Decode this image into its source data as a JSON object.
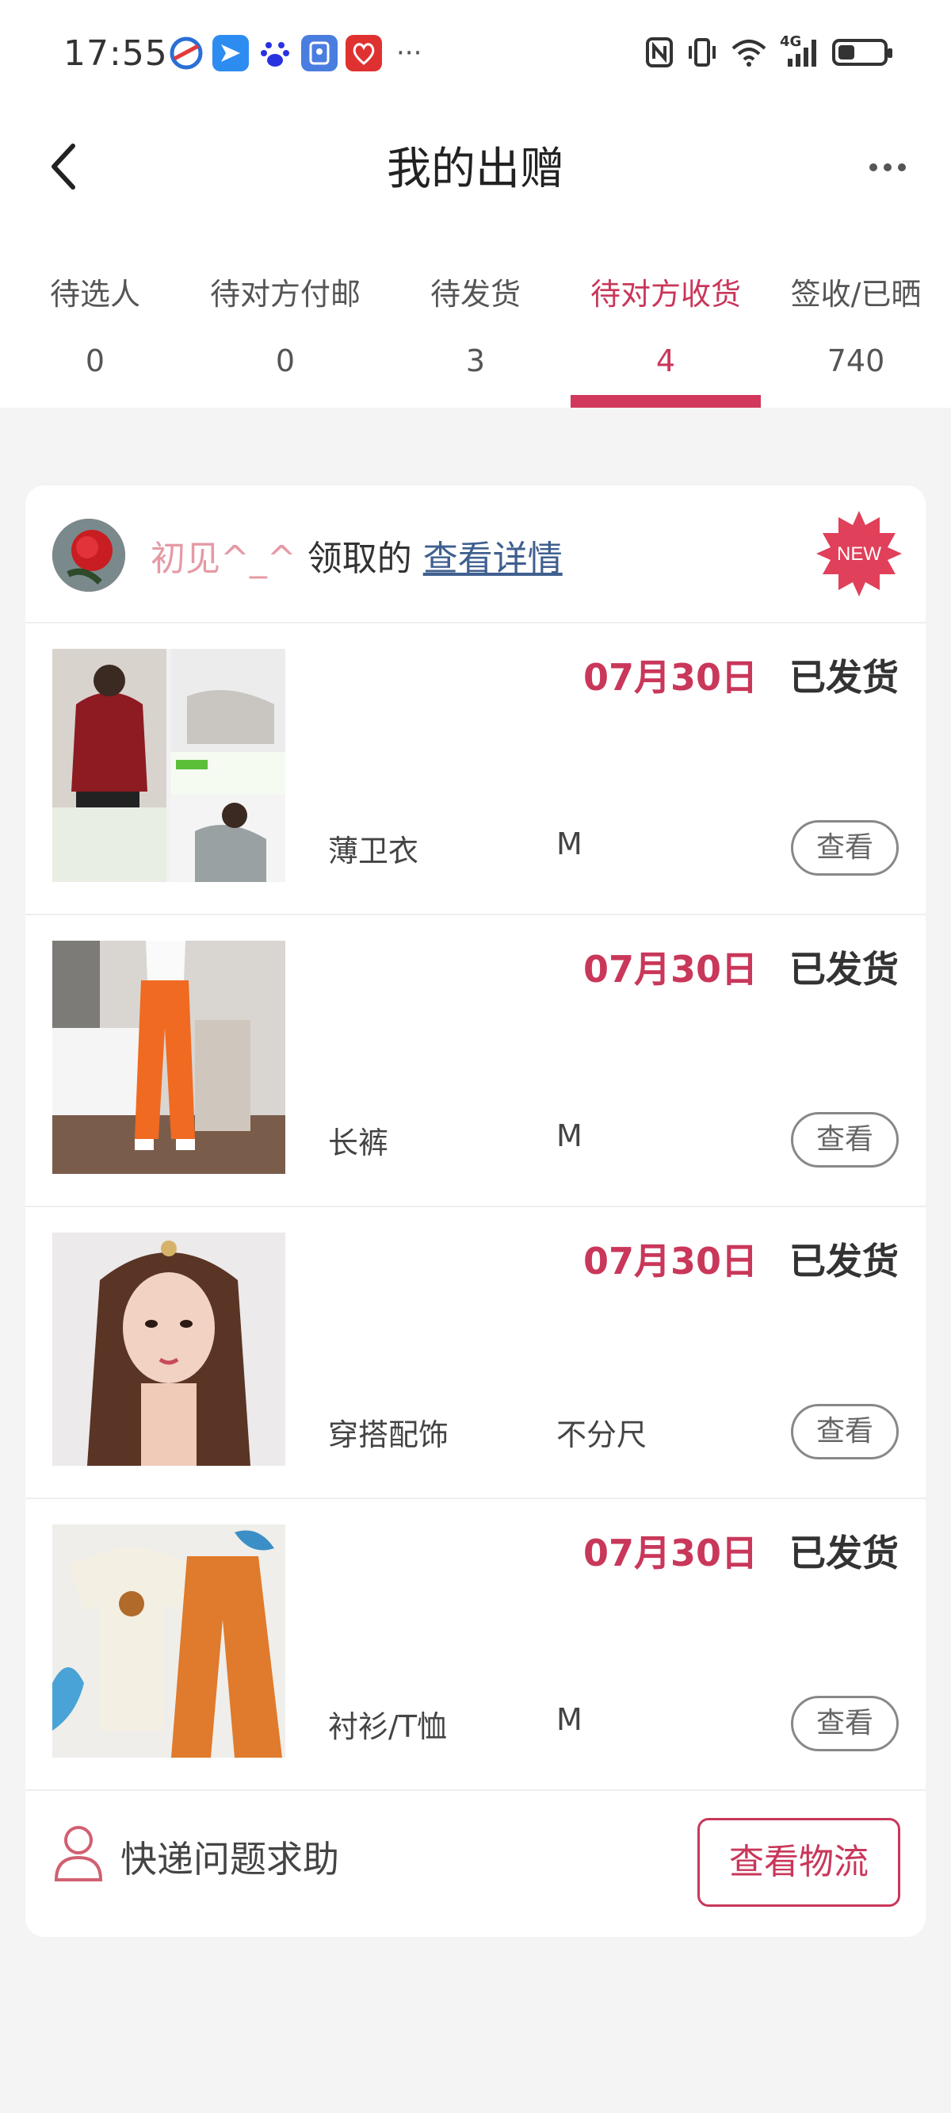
{
  "status_bar": {
    "time": "17:55",
    "notification_icons": [
      "browser-icon",
      "message-icon",
      "baidu-icon",
      "security-icon",
      "gift-icon"
    ],
    "more_indicator": "···",
    "right_icons": [
      "nfc-icon",
      "vibrate-icon",
      "wifi-icon",
      "signal-4g-icon",
      "battery-icon"
    ],
    "network_label": "4G",
    "battery_level": 0.35
  },
  "header": {
    "title": "我的出赠",
    "back_icon": "chevron-left-icon",
    "more_icon": "more-horizontal-icon"
  },
  "tabs": [
    {
      "label": "待选人",
      "count": "0",
      "active": false
    },
    {
      "label": "待对方付邮",
      "count": "0",
      "active": false
    },
    {
      "label": "待发货",
      "count": "3",
      "active": false
    },
    {
      "label": "待对方收货",
      "count": "4",
      "active": true
    },
    {
      "label": "签收/已晒",
      "count": "740",
      "active": false
    }
  ],
  "card": {
    "user": "初见^_^",
    "claimed_text": " 领取的 ",
    "detail_link": "查看详情",
    "badge": "NEW",
    "items": [
      {
        "date": "07月30日",
        "status": "已发货",
        "name": "薄卫衣",
        "size": "M",
        "action": "查看"
      },
      {
        "date": "07月30日",
        "status": "已发货",
        "name": "长裤",
        "size": "M",
        "action": "查看"
      },
      {
        "date": "07月30日",
        "status": "已发货",
        "name": "穿搭配饰",
        "size": "不分尺",
        "action": "查看"
      },
      {
        "date": "07月30日",
        "status": "已发货",
        "name": "衬衫/T恤",
        "size": "M",
        "action": "查看"
      }
    ],
    "help_label": "快递问题求助",
    "track_button": "查看物流"
  },
  "colors": {
    "accent": "#d2375c",
    "link": "#3f5f8f",
    "username": "#e59aa5"
  }
}
